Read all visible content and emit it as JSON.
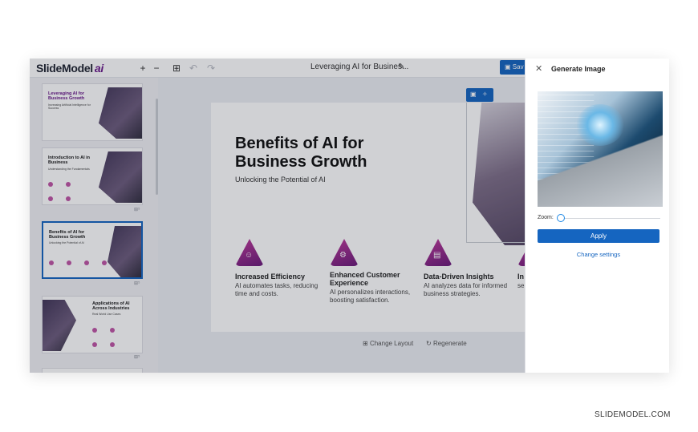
{
  "app": {
    "logo_text": "SlideModel",
    "logo_ai": "ai",
    "document_title": "Leveraging AI for Busines...",
    "save_label": "Sav"
  },
  "toolbar": {
    "zoom_in_icon": "+",
    "zoom_out_icon": "−",
    "grid_icon": "⊞",
    "undo_icon": "↶",
    "redo_icon": "↷",
    "edit_icon": "✎"
  },
  "thumbnails": [
    {
      "title": "Leveraging AI for Business Growth",
      "subtitle": "Increasing Artificial Intelligence for Success",
      "badge": ""
    },
    {
      "title": "Introduction to AI in Business",
      "subtitle": "Understanding the Fundamentals",
      "badge": "⊞⁵"
    },
    {
      "title": "Benefits of AI for Business Growth",
      "subtitle": "Unlocking the Potential of AI",
      "badge": "⊞⁵"
    },
    {
      "title": "Applications of AI Across Industries",
      "subtitle": "Real World Use Cases",
      "badge": "⊞⁵"
    }
  ],
  "slide": {
    "title": "Benefits of AI for Business Growth",
    "subtitle": "Unlocking the Potential of AI",
    "features": [
      {
        "icon": "person-icon",
        "glyph": "☺",
        "title": "Increased Efficiency",
        "desc": "AI automates tasks, reducing time and costs."
      },
      {
        "icon": "gear-icon",
        "glyph": "⚙",
        "title": "Enhanced Customer Experience",
        "desc": "AI personalizes interactions, boosting satisfaction."
      },
      {
        "icon": "chart-icon",
        "glyph": "▤",
        "title": "Data-Driven Insights",
        "desc": "AI analyzes data for informed business strategies."
      },
      {
        "icon": "innovation-icon",
        "glyph": "✦",
        "title": "In",
        "desc": "se"
      }
    ]
  },
  "slide_actions": {
    "change_layout": "Change Layout",
    "regenerate": "Regenerate"
  },
  "panel": {
    "title": "Generate Image",
    "close_icon": "✕",
    "zoom_label": "Zoom:",
    "apply_label": "Apply",
    "change_settings_label": "Change settings"
  },
  "watermark": "SLIDEMODEL.COM",
  "colors": {
    "accent_blue": "#1565c0",
    "brand_purple": "#6a1a8a"
  }
}
